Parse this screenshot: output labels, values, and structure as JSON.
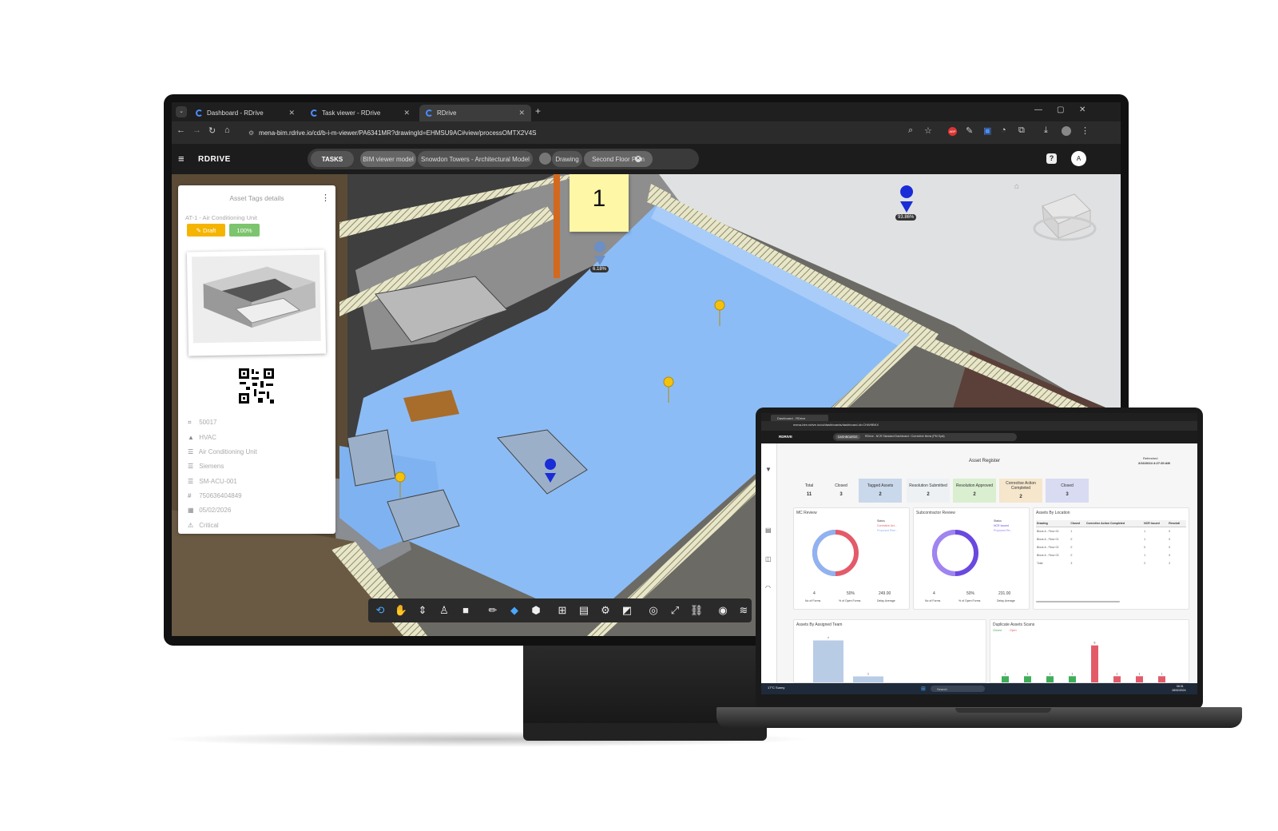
{
  "browser": {
    "tabs": [
      {
        "label": "Dashboard - RDrive"
      },
      {
        "label": "Task viewer - RDrive"
      },
      {
        "label": "RDrive"
      }
    ],
    "new_tab": "+",
    "url": "mena-bim.rdrive.io/cd/b-i-m-viewer/PA6341MR?drawingId=EHMSU9AC#view/processOMTX2V4S"
  },
  "app": {
    "logo": "RDRIVE",
    "tasks_label": "TASKS",
    "breadcrumb": {
      "model_label": "BIM viewer model",
      "model_value": "Snowdon Towers - Architectural Model",
      "drawing_label": "Drawing",
      "drawing_value": "Second Floor Plan"
    },
    "help": "?",
    "avatar": "A"
  },
  "viewer": {
    "sticky_note": "1",
    "markers": [
      {
        "label": "93.86%"
      },
      {
        "label": "6.18%"
      }
    ]
  },
  "asset_panel": {
    "title": "Asset Tags details",
    "asset_name": "AT-1 - Air Conditioning Unit",
    "status_badge": "Draft",
    "progress_badge": "100%",
    "properties": [
      {
        "icon": "barcode-icon",
        "value": "50017"
      },
      {
        "icon": "shapes-icon",
        "value": "HVAC"
      },
      {
        "icon": "list-icon",
        "value": "Air Conditioning Unit"
      },
      {
        "icon": "list-icon",
        "value": "Siemens"
      },
      {
        "icon": "list-icon",
        "value": "SM-ACU-001"
      },
      {
        "icon": "number-icon",
        "value": "750636404849"
      },
      {
        "icon": "calendar-icon",
        "value": "05/02/2026"
      },
      {
        "icon": "warning-icon",
        "value": "Critical"
      }
    ]
  },
  "laptop": {
    "tab": "Dashboard - RDrive",
    "url": "mena-bim.rdrive.io/cd/dashboards/dashboard-id=CHW9BKX",
    "dashboard_tag": "DASHBOARDS",
    "breadcrumb": "RDrive - NCR Standard Dashboard › Corrective Items (PM Syst)",
    "title": "Asset Register",
    "refreshed_label": "Refreshed",
    "refreshed_value": "2/16/2024 4:27:30 AM",
    "stats": [
      {
        "label": "Total",
        "value": "11",
        "color": "#f4f4f4"
      },
      {
        "label": "Closed",
        "value": "3",
        "color": "#f4f4f4"
      },
      {
        "label": "Tagged Assets",
        "value": "2",
        "color": "#c9d8ea"
      },
      {
        "label": "Resolution Submitted",
        "value": "2",
        "color": "#eef1f4"
      },
      {
        "label": "Resolution Approved",
        "value": "2",
        "color": "#d9efd0"
      },
      {
        "label": "Corrective Action Completed",
        "value": "2",
        "color": "#f5e6cc"
      },
      {
        "label": "Closed",
        "value": "3",
        "color": "#d8dbf2"
      }
    ],
    "mc_review": {
      "title": "MC Review",
      "status_label": "Status",
      "legend": [
        "Corrective Act...",
        "Proposed Rem..."
      ],
      "metrics": [
        {
          "value": "4",
          "label": "No of Forms"
        },
        {
          "value": "50%",
          "label": "% of Open Forms"
        },
        {
          "value": "249.00",
          "label": "Delay Average"
        }
      ]
    },
    "sub_review": {
      "title": "Subcontractor Review",
      "status_label": "Status",
      "legend": [
        "NCR Issued",
        "Proposed Re..."
      ],
      "metrics": [
        {
          "value": "4",
          "label": "No of Forms"
        },
        {
          "value": "50%",
          "label": "% of Open Forms"
        },
        {
          "value": "231.00",
          "label": "Delay Average"
        }
      ]
    },
    "location": {
      "title": "Assets By Location",
      "headers": [
        "Drawing",
        "Closed",
        "Corrective Action Completed",
        "NCR Issued",
        "Resoluti"
      ],
      "rows": [
        [
          "Block A - Floor 00",
          "1",
          "",
          "1",
          "0"
        ],
        [
          "Block A - Floor 01",
          "0",
          "",
          "1",
          "0"
        ],
        [
          "Block A - Floor 02",
          "0",
          "",
          "0",
          "0"
        ],
        [
          "Block A - Floor 03",
          "0",
          "",
          "1",
          "0"
        ],
        [
          "Total",
          "3",
          "",
          "2",
          "2"
        ]
      ]
    },
    "team_title": "Assets By Assigned Team",
    "duplicate_title": "Duplicate Assets Scans",
    "duplicate_legend": [
      "Closed",
      "Open"
    ],
    "taskbar": {
      "weather": "17°C Sunny",
      "search": "Search",
      "time": "06:31",
      "date": "18/02/2024"
    }
  },
  "chart_data": [
    {
      "type": "bar",
      "title": "Assets By Assigned Team",
      "categories": [
        "",
        ""
      ],
      "values": [
        7,
        1
      ]
    },
    {
      "type": "bar",
      "title": "Duplicate Assets Scans",
      "series": [
        {
          "name": "Closed",
          "values": [
            1,
            1,
            1,
            1,
            0,
            0,
            0,
            0
          ]
        },
        {
          "name": "Open",
          "values": [
            0,
            0,
            0,
            0,
            6,
            1,
            1,
            1
          ]
        }
      ],
      "categories": [
        "",
        "",
        "",
        "",
        "",
        "",
        "",
        ""
      ]
    }
  ]
}
